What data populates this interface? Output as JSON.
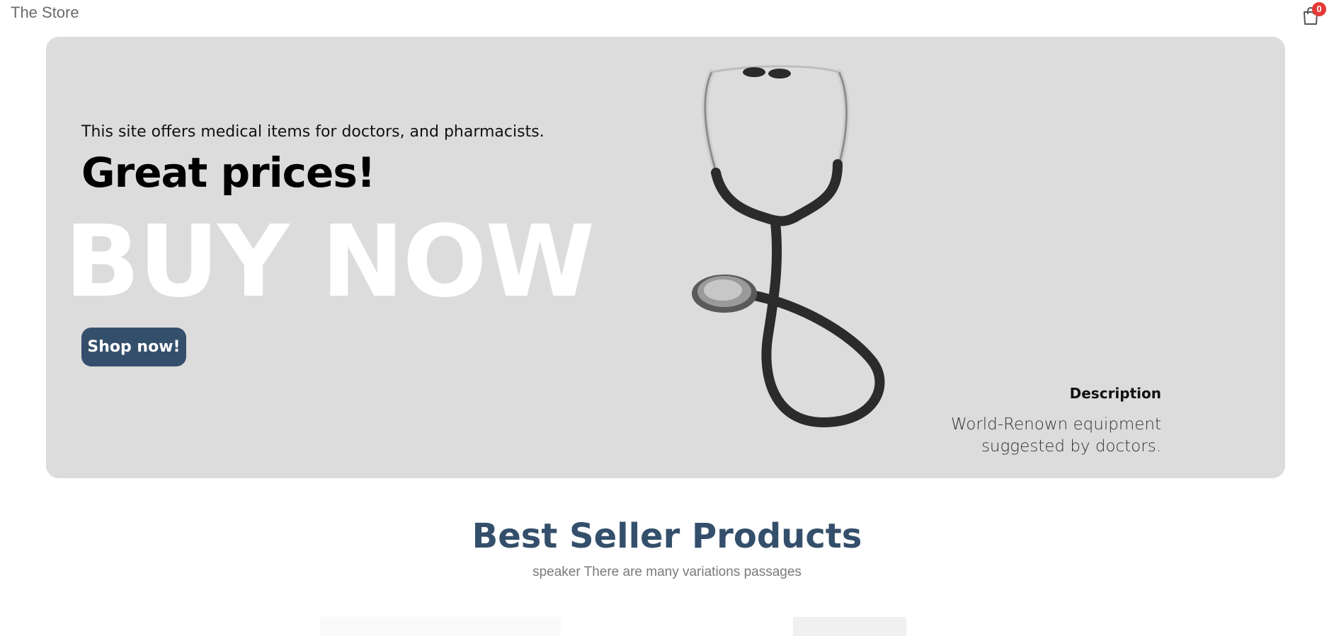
{
  "navbar": {
    "brand": "The Store",
    "cart_count": "0"
  },
  "hero": {
    "intro": "This site offers medical items for doctors, and pharmacists.",
    "headline": "Great prices!",
    "big_text": "BUY NOW",
    "button_label": "Shop now!",
    "description_title": "Description",
    "description_text": "World-Renown equipment suggested by doctors.",
    "image": "stethoscope"
  },
  "best_sellers": {
    "title": "Best Seller Products",
    "subtitle": "speaker There are many variations passages"
  },
  "colors": {
    "hero_bg": "#dcdcdc",
    "accent": "#344f6b",
    "badge": "#e53935"
  }
}
